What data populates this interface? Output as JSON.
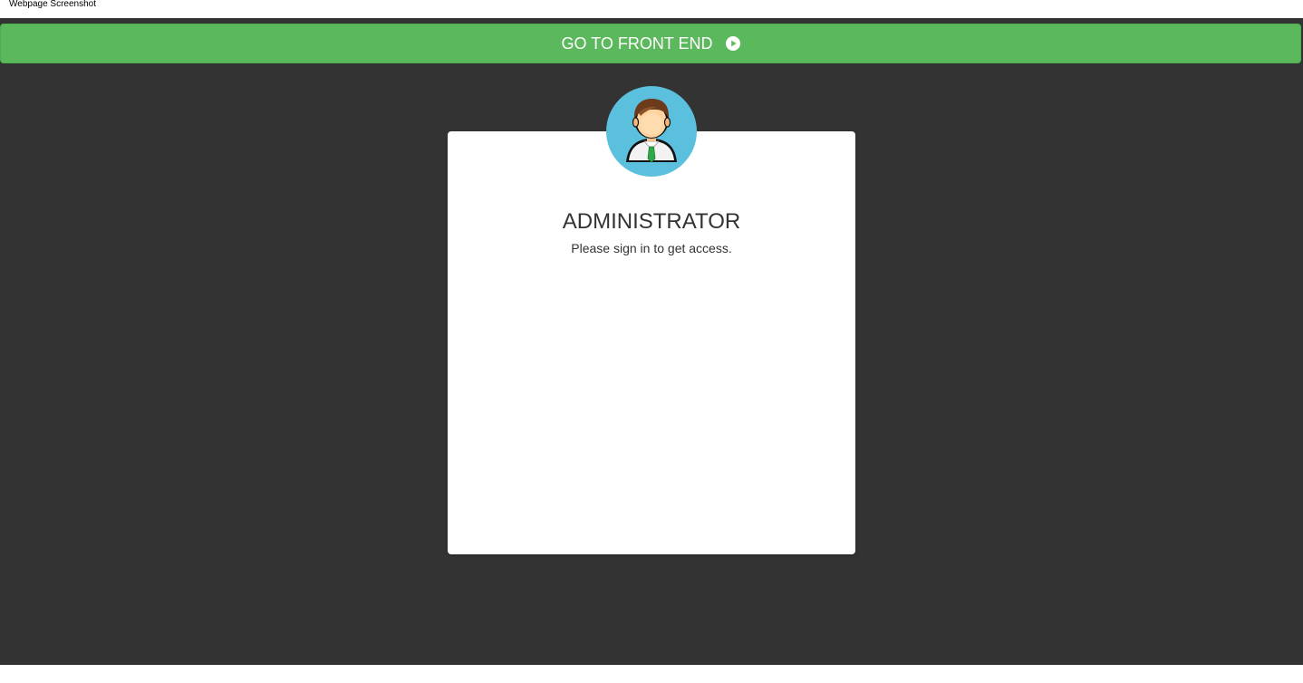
{
  "window": {
    "title": "Webpage Screenshot"
  },
  "header": {
    "front_end_label": "GO TO FRONT END",
    "front_end_icon": "play-circle-icon"
  },
  "login": {
    "avatar_icon": "admin-user-avatar-icon",
    "title": "ADMINISTRATOR",
    "subtitle": "Please sign in to get access."
  },
  "colors": {
    "page_background": "#333333",
    "button_green": "#5cb85c",
    "avatar_background": "#5bc0de",
    "card_background": "#ffffff",
    "text_dark": "#333333"
  }
}
